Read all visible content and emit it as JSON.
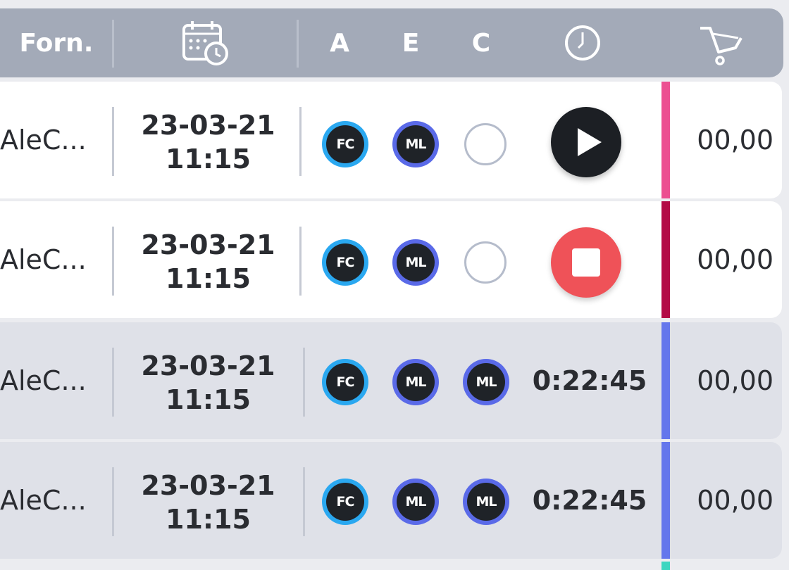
{
  "header": {
    "forn_label": "Forn.",
    "date_icon": "calendar-clock-icon",
    "col_a": "A",
    "col_e": "E",
    "col_c": "C",
    "time_icon": "clock-icon",
    "cart_icon": "cart-icon"
  },
  "rows": [
    {
      "forn": "AleC...",
      "date": "23-03-21",
      "time": "11:15",
      "a": "FC",
      "e": "ML",
      "c": "",
      "status": "play",
      "amount": "00,00",
      "stripe_color": "#ec4f91"
    },
    {
      "forn": "AleC...",
      "date": "23-03-21",
      "time": "11:15",
      "a": "FC",
      "e": "ML",
      "c": "",
      "status": "stop",
      "amount": "00,00",
      "stripe_color": "#b30a46"
    },
    {
      "forn": "AleC...",
      "date": "23-03-21",
      "time": "11:15",
      "a": "FC",
      "e": "ML",
      "c": "ML",
      "status": "0:22:45",
      "amount": "00,00",
      "stripe_color": "#6476ec"
    },
    {
      "forn": "AleC...",
      "date": "23-03-21",
      "time": "11:15",
      "a": "FC",
      "e": "ML",
      "c": "ML",
      "status": "0:22:45",
      "amount": "00,00",
      "stripe_color": "#6476ec"
    }
  ],
  "bottom_stripe_color": "#3dd6c0"
}
